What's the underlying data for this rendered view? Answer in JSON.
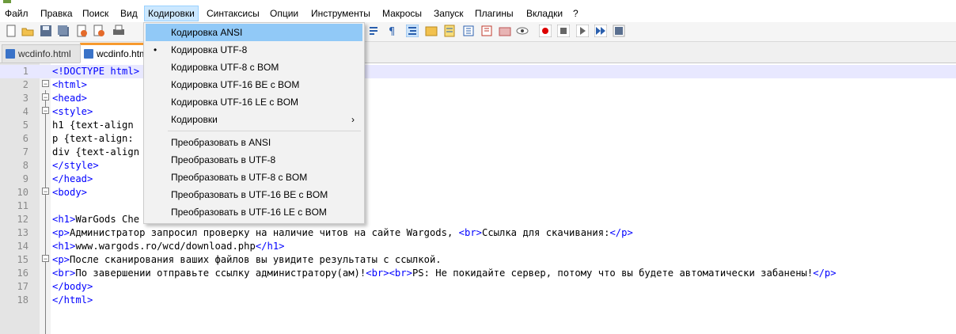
{
  "menubar": {
    "items": [
      "Файл",
      "Правка",
      "Поиск",
      "Вид",
      "Кодировки",
      "Синтаксисы",
      "Опции",
      "Инструменты",
      "Макросы",
      "Запуск",
      "Плагины",
      "Вкладки",
      "?"
    ]
  },
  "tabs": [
    {
      "label": "wcdinfo.html",
      "active": false
    },
    {
      "label": "wcdinfo.html",
      "active": true
    }
  ],
  "dropdown": {
    "items": [
      {
        "label": "Кодировка ANSI",
        "highlighted": true
      },
      {
        "label": "Кодировка UTF-8",
        "checked": true
      },
      {
        "label": "Кодировка UTF-8 с BOM"
      },
      {
        "label": "Кодировка UTF-16 BE с BOM"
      },
      {
        "label": "Кодировка UTF-16 LE с BOM"
      },
      {
        "label": "Кодировки",
        "submenu": true
      }
    ],
    "convert_items": [
      {
        "label": "Преобразовать в ANSI"
      },
      {
        "label": "Преобразовать в UTF-8"
      },
      {
        "label": "Преобразовать в UTF-8 с BOM"
      },
      {
        "label": "Преобразовать в UTF-16 BE с BOM"
      },
      {
        "label": "Преобразовать в UTF-16 LE с BOM"
      }
    ],
    "check_glyph": "•",
    "submenu_glyph": "›"
  },
  "editor": {
    "lines": [
      [
        {
          "t": "<!DOCTYPE html>",
          "c": "tag"
        }
      ],
      [
        {
          "t": "<html>",
          "c": "tag"
        }
      ],
      [
        {
          "t": "<head>",
          "c": "tag"
        }
      ],
      [
        {
          "t": "<style>",
          "c": "tag"
        }
      ],
      [
        {
          "t": "h1 {text-align",
          "c": "txt"
        }
      ],
      [
        {
          "t": "p {text-align:",
          "c": "txt"
        }
      ],
      [
        {
          "t": "div {text-align",
          "c": "txt"
        }
      ],
      [
        {
          "t": "</style>",
          "c": "tag"
        }
      ],
      [
        {
          "t": "</head>",
          "c": "tag"
        }
      ],
      [
        {
          "t": "<body>",
          "c": "tag"
        }
      ],
      [],
      [
        {
          "t": "<h1>",
          "c": "tag"
        },
        {
          "t": "WarGods Che",
          "c": "txt"
        }
      ],
      [
        {
          "t": "<p>",
          "c": "tag"
        },
        {
          "t": "Администратор запросил проверку на наличие читов на сайте Wargods, ",
          "c": "txt"
        },
        {
          "t": "<br>",
          "c": "tag"
        },
        {
          "t": "Ссылка для скачивания:",
          "c": "txt"
        },
        {
          "t": "</p>",
          "c": "tag"
        }
      ],
      [
        {
          "t": "<h1>",
          "c": "tag"
        },
        {
          "t": "www.wargods.ro/wcd/download.php",
          "c": "txt"
        },
        {
          "t": "</h1>",
          "c": "tag"
        }
      ],
      [
        {
          "t": "<p>",
          "c": "tag"
        },
        {
          "t": "После сканирования ваших файлов вы увидите результаты с ссылкой.",
          "c": "txt"
        }
      ],
      [
        {
          "t": "<br>",
          "c": "tag"
        },
        {
          "t": "По завершении отправьте ссылку администратору(ам)!",
          "c": "txt"
        },
        {
          "t": "<br><br>",
          "c": "tag"
        },
        {
          "t": "PS: Не покидайте сервер, потому что вы будете автоматически забанены!",
          "c": "txt"
        },
        {
          "t": "</p>",
          "c": "tag"
        }
      ],
      [
        {
          "t": "</body>",
          "c": "tag"
        }
      ],
      [
        {
          "t": "</html>",
          "c": "tag"
        }
      ]
    ],
    "highlighted_line": 1
  },
  "colors": {
    "tag": "#0000ff",
    "text": "#000000",
    "menu_hover": "#91c9f7",
    "active_tab_accent": "#f79a2e"
  },
  "toolbar_icons": [
    "new-file-icon",
    "open-file-icon",
    "save-icon",
    "save-all-icon",
    "close-icon",
    "close-all-icon",
    "print-icon",
    "word-wrap-icon",
    "show-all-chars-icon",
    "indent-guide-icon",
    "folder-as-workspace-icon",
    "doc-map-icon",
    "function-list-icon",
    "doc-list-icon",
    "monitoring-icon",
    "record-macro-icon",
    "stop-record-icon",
    "play-macro-icon",
    "run-macro-multiple-icon",
    "save-macro-icon"
  ]
}
